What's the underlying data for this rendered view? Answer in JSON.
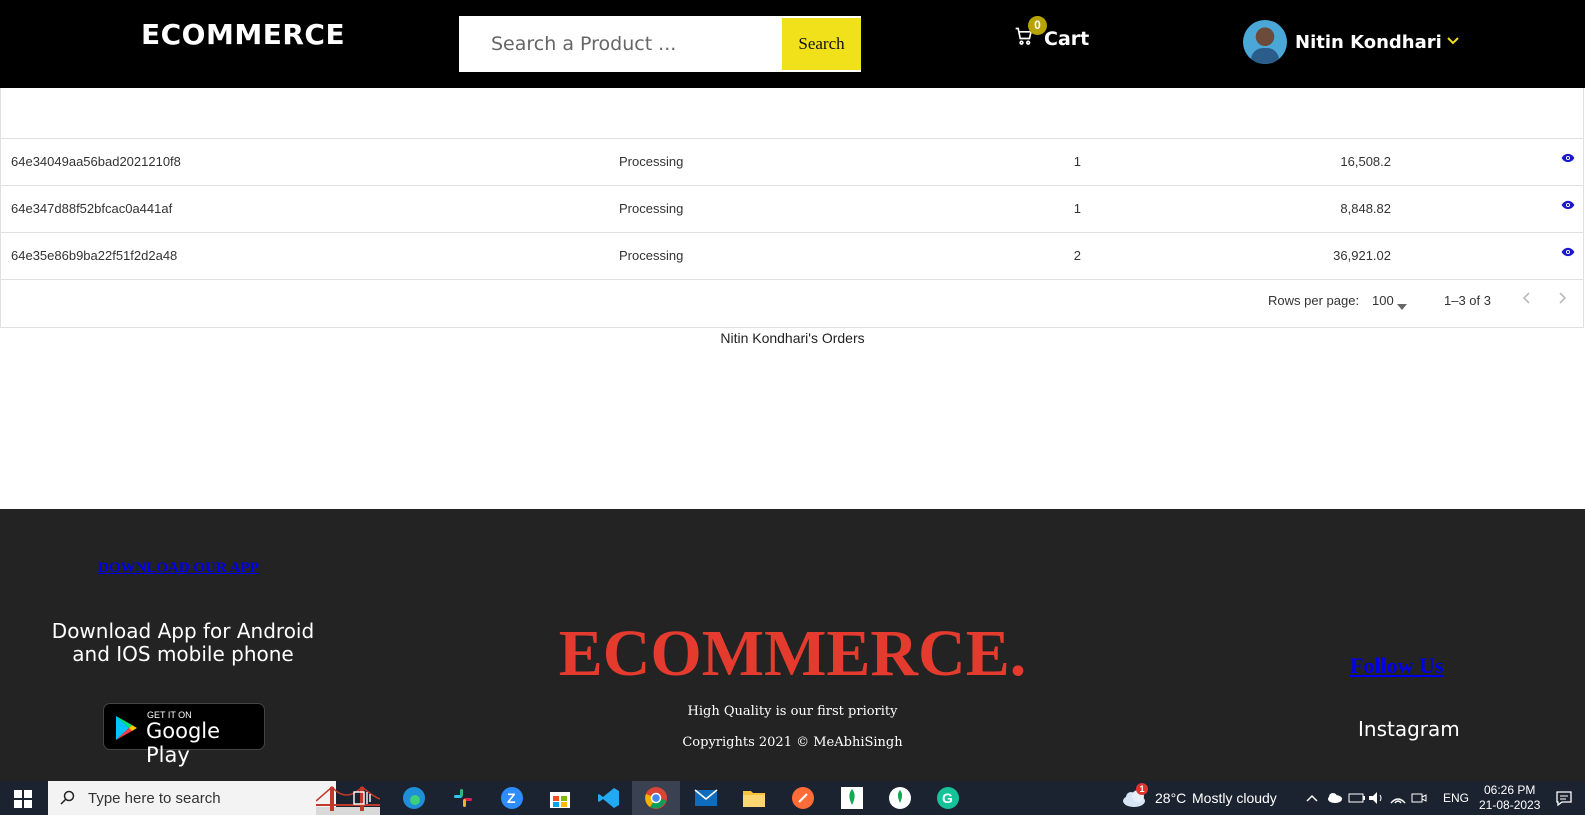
{
  "header": {
    "logo": "ECOMMERCE",
    "search_placeholder": "Search a Product ...",
    "search_button": "Search",
    "cart_count": "0",
    "cart_label": "Cart",
    "user_name": "Nitin Kondhari"
  },
  "orders": {
    "rows": [
      {
        "id": "64e34049aa56bad2021210f8",
        "status": "Processing",
        "qty": "1",
        "amount": "16,508.2"
      },
      {
        "id": "64e347d88f52bfcac0a441af",
        "status": "Processing",
        "qty": "1",
        "amount": "8,848.82"
      },
      {
        "id": "64e35e86b9ba22f51f2d2a48",
        "status": "Processing",
        "qty": "2",
        "amount": "36,921.02"
      }
    ],
    "rows_per_page_label": "Rows per page:",
    "rows_per_page_value": "100",
    "range": "1–3 of 3",
    "caption": "Nitin Kondhari's Orders"
  },
  "footer": {
    "download_title": "DOWNLOAD OUR APP",
    "download_text": "Download App for Android and IOS mobile phone",
    "gplay_small": "GET IT ON",
    "gplay_big": "Google Play",
    "brand": "ECOMMERCE.",
    "tagline": "High Quality is our first priority",
    "copyright": "Copyrights 2021 © MeAbhiSingh",
    "follow": "Follow Us",
    "instagram": "Instagram"
  },
  "taskbar": {
    "search_text": "Type here to search",
    "weather_temp": "28°C",
    "weather_desc": "Mostly cloudy",
    "weather_badge": "1",
    "language": "ENG",
    "time": "06:26 PM",
    "date": "21-08-2023",
    "icons": [
      "edge-icon",
      "slack-icon",
      "zoom-icon",
      "store-icon",
      "vscode-icon",
      "chrome-icon",
      "mail-icon",
      "explorer-icon",
      "postman-icon",
      "mongodb-icon",
      "mongodb-compass-icon",
      "grammarly-icon"
    ]
  },
  "colors": {
    "accent_yellow": "#f0e11b",
    "brand_red": "#e53b2f",
    "link_blue": "#0000ee",
    "action_icon": "#1a1acc",
    "footer_bg": "#232323"
  }
}
